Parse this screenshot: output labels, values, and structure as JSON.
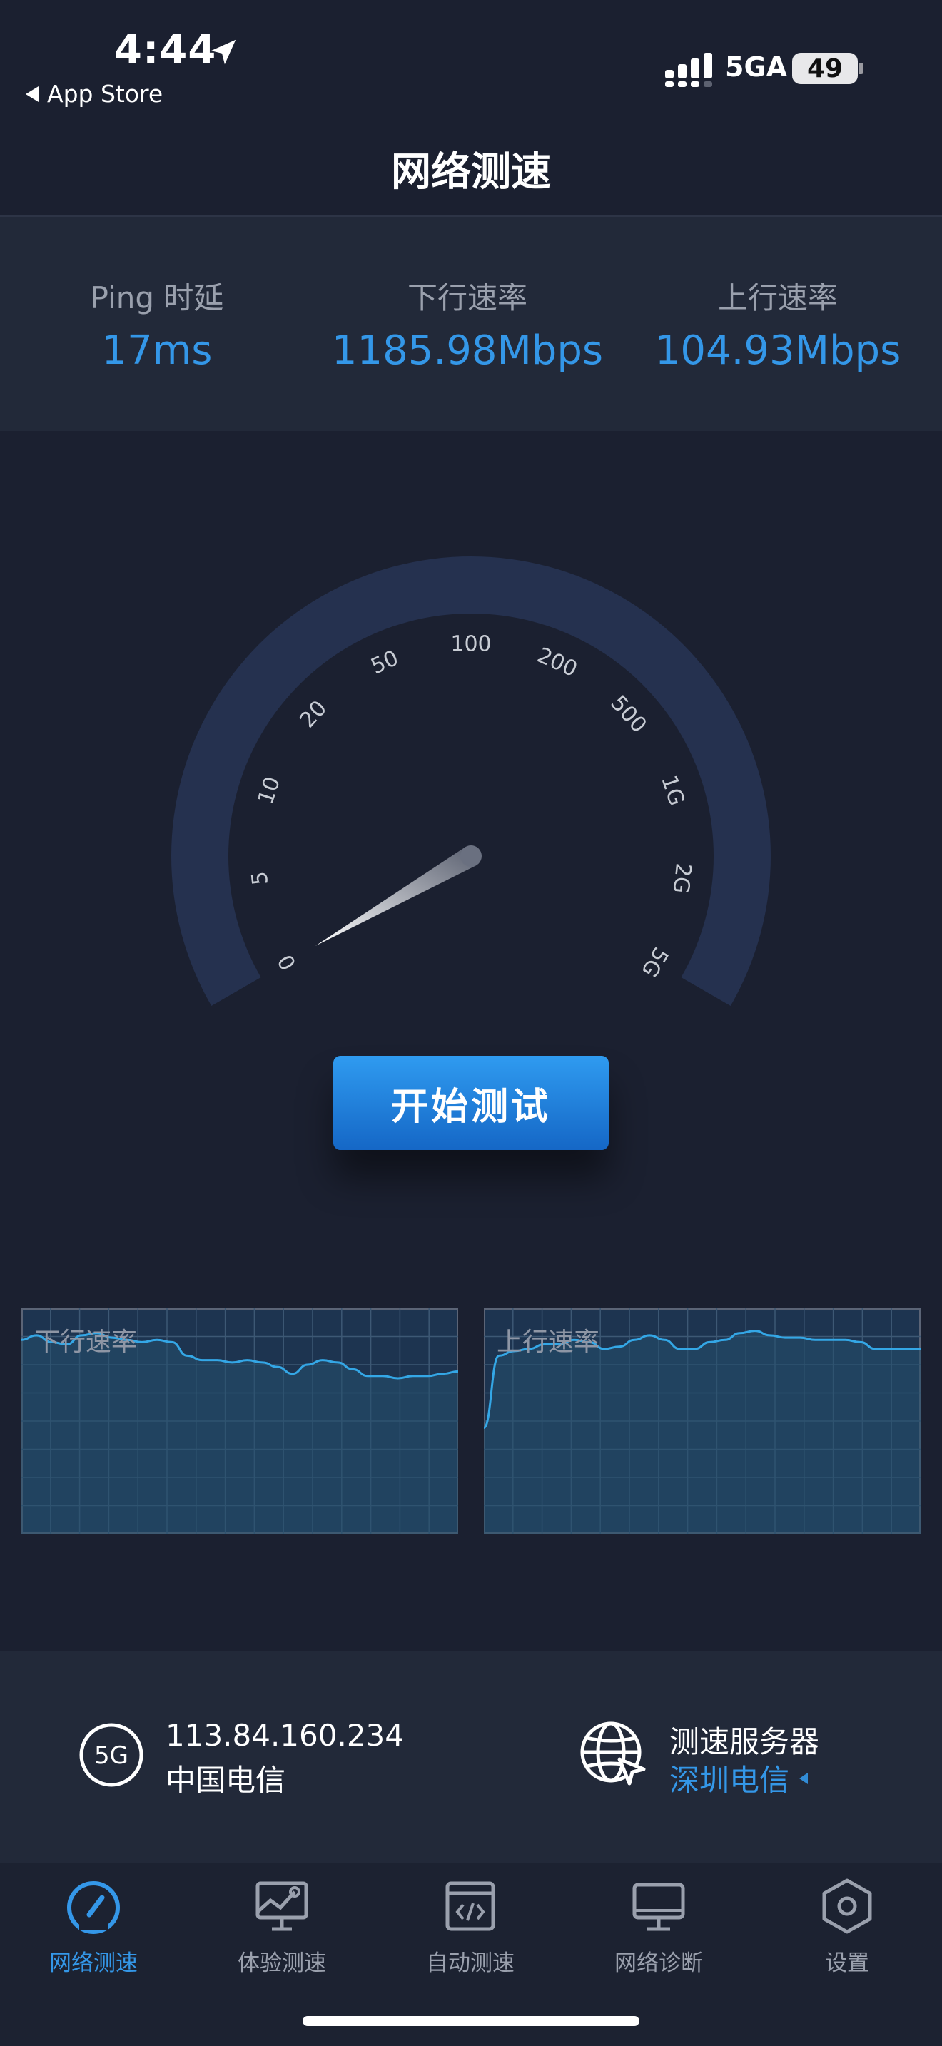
{
  "status_bar": {
    "time": "4:44",
    "back_label": "App Store",
    "network": "5GA",
    "battery": "49"
  },
  "title": "网络测速",
  "stats": {
    "ping_label": "Ping 时延",
    "ping_value": "17ms",
    "download_label": "下行速率",
    "download_value": "1185.98Mbps",
    "upload_label": "上行速率",
    "upload_value": "104.93Mbps"
  },
  "gauge": {
    "scale_labels": [
      "0",
      "5",
      "10",
      "20",
      "50",
      "100",
      "200",
      "500",
      "1G",
      "2G",
      "5G"
    ],
    "needle_value": "0",
    "colors": {
      "arc": "#25314f",
      "text": "#c8ccd4"
    }
  },
  "start_button": {
    "label": "开始测试"
  },
  "charts": {
    "download": {
      "label": "下行速率"
    },
    "upload": {
      "label": "上行速率"
    }
  },
  "chart_data": [
    {
      "type": "area",
      "x": [
        0,
        1,
        2,
        3,
        4,
        5,
        6,
        7,
        8,
        9,
        10,
        11,
        12,
        13,
        14,
        15,
        16,
        17,
        18,
        19,
        20,
        21,
        22,
        23,
        24,
        25,
        26,
        27,
        28,
        29
      ],
      "values": [
        0.86,
        0.88,
        0.85,
        0.84,
        0.88,
        0.89,
        0.87,
        0.86,
        0.85,
        0.86,
        0.85,
        0.79,
        0.77,
        0.77,
        0.76,
        0.77,
        0.76,
        0.74,
        0.71,
        0.75,
        0.77,
        0.76,
        0.73,
        0.7,
        0.7,
        0.69,
        0.7,
        0.7,
        0.71,
        0.72
      ],
      "ylim": [
        0,
        1
      ]
    },
    {
      "type": "area",
      "x": [
        0,
        1,
        2,
        3,
        4,
        5,
        6,
        7,
        8,
        9,
        10,
        11,
        12,
        13,
        14,
        15,
        16,
        17,
        18,
        19,
        20,
        21,
        22,
        23,
        24,
        25,
        26,
        27,
        28,
        29
      ],
      "values": [
        0.47,
        0.79,
        0.81,
        0.82,
        0.84,
        0.84,
        0.86,
        0.85,
        0.82,
        0.83,
        0.86,
        0.88,
        0.86,
        0.82,
        0.82,
        0.85,
        0.86,
        0.89,
        0.9,
        0.88,
        0.87,
        0.87,
        0.86,
        0.86,
        0.86,
        0.85,
        0.82,
        0.82,
        0.82,
        0.82
      ],
      "ylim": [
        0,
        1
      ]
    }
  ],
  "info": {
    "ip": "113.84.160.234",
    "isp": "中国电信",
    "server_title": "测速服务器",
    "server_name": "深圳电信",
    "badge": "5G"
  },
  "nav": [
    {
      "label": "网络测速",
      "icon": "speedometer-icon",
      "active": true
    },
    {
      "label": "体验测速",
      "icon": "monitor-chart-icon",
      "active": false
    },
    {
      "label": "自动测速",
      "icon": "code-window-icon",
      "active": false
    },
    {
      "label": "网络诊断",
      "icon": "desktop-icon",
      "active": false
    },
    {
      "label": "设置",
      "icon": "settings-hex-icon",
      "active": false
    }
  ]
}
